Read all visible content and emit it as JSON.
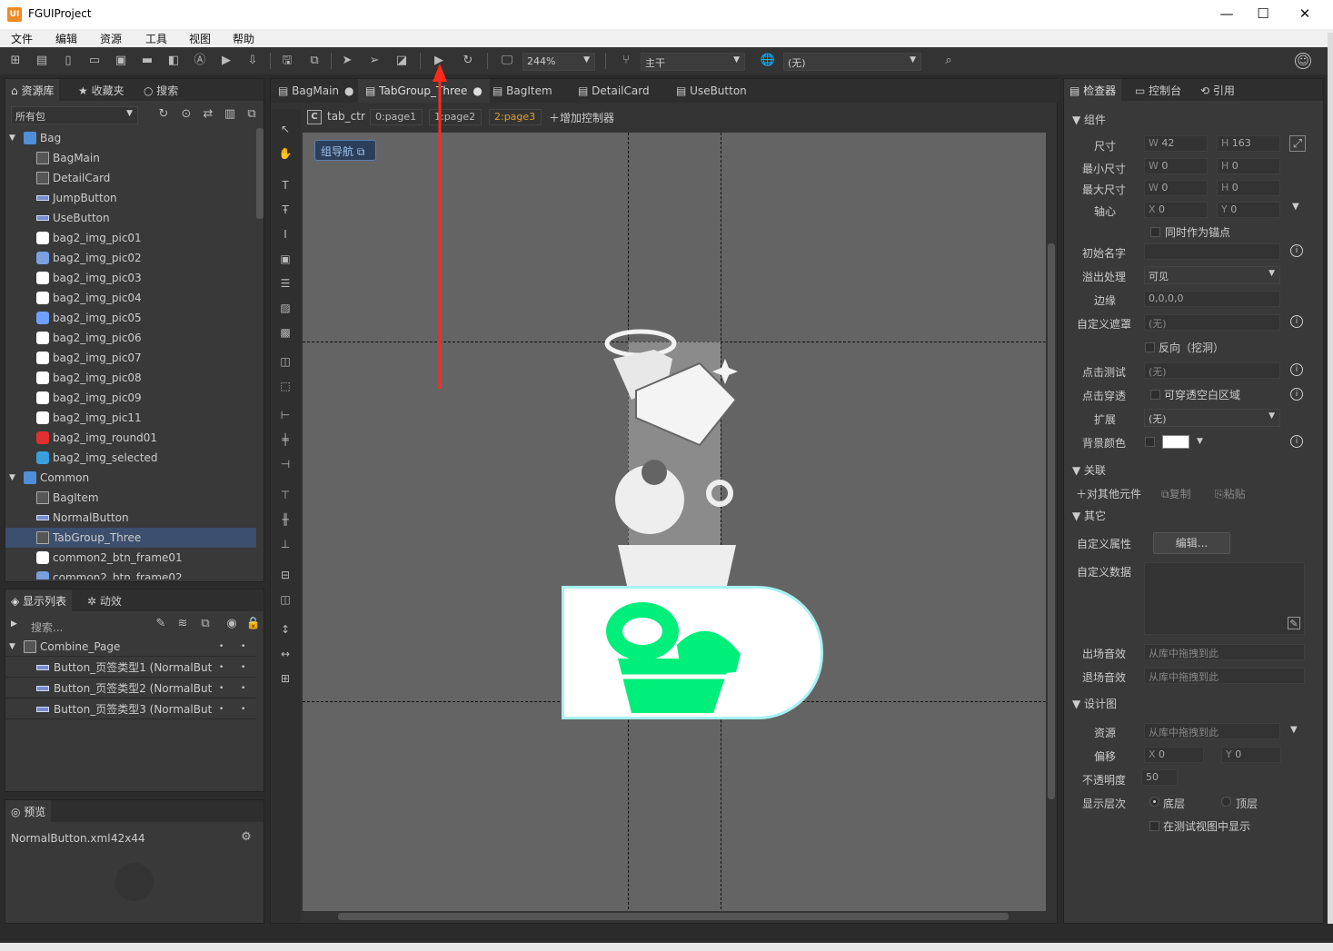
{
  "window": {
    "title": "FGUIProject",
    "logo": "UI",
    "minimize": "—",
    "maximize": "☐",
    "close": "✕"
  },
  "menu": [
    "文件",
    "编辑",
    "资源",
    "工具",
    "视图",
    "帮助"
  ],
  "toolbar": {
    "zoom": "244%",
    "branch": "主干",
    "language": "(无)"
  },
  "left": {
    "tabs": [
      "资源库",
      "收藏夹",
      "搜索"
    ],
    "package_filter": "所有包",
    "tree": [
      {
        "label": "Bag",
        "type": "folder",
        "indent": 0
      },
      {
        "label": "BagMain",
        "type": "component",
        "indent": 1
      },
      {
        "label": "DetailCard",
        "type": "component",
        "indent": 1
      },
      {
        "label": "JumpButton",
        "type": "button",
        "indent": 1
      },
      {
        "label": "UseButton",
        "type": "button",
        "indent": 1
      },
      {
        "label": "bag2_img_pic01",
        "type": "image",
        "indent": 1
      },
      {
        "label": "bag2_img_pic02",
        "type": "image",
        "indent": 1
      },
      {
        "label": "bag2_img_pic03",
        "type": "image",
        "indent": 1
      },
      {
        "label": "bag2_img_pic04",
        "type": "image",
        "indent": 1
      },
      {
        "label": "bag2_img_pic05",
        "type": "image",
        "indent": 1
      },
      {
        "label": "bag2_img_pic06",
        "type": "image",
        "indent": 1
      },
      {
        "label": "bag2_img_pic07",
        "type": "image",
        "indent": 1
      },
      {
        "label": "bag2_img_pic08",
        "type": "image",
        "indent": 1
      },
      {
        "label": "bag2_img_pic09",
        "type": "image",
        "indent": 1
      },
      {
        "label": "bag2_img_pic11",
        "type": "image",
        "indent": 1
      },
      {
        "label": "bag2_img_round01",
        "type": "image",
        "indent": 1
      },
      {
        "label": "bag2_img_selected",
        "type": "image",
        "indent": 1
      },
      {
        "label": "Common",
        "type": "folder",
        "indent": 0
      },
      {
        "label": "BagItem",
        "type": "component",
        "indent": 1
      },
      {
        "label": "NormalButton",
        "type": "button",
        "indent": 1
      },
      {
        "label": "TabGroup_Three",
        "type": "component",
        "indent": 1,
        "selected": true
      },
      {
        "label": "common2_btn_frame01",
        "type": "image",
        "indent": 1
      },
      {
        "label": "common2_btn_frame02",
        "type": "image",
        "indent": 1
      }
    ],
    "display_tabs": [
      "显示列表",
      "动效"
    ],
    "display_search_placeholder": "搜索...",
    "display_list": [
      {
        "label": "Combine_Page"
      },
      {
        "label": "Button_页签类型1 (NormalBut"
      },
      {
        "label": "Button_页签类型2 (NormalBut"
      },
      {
        "label": "Button_页签类型3 (NormalBut"
      }
    ],
    "preview_tab": "预览",
    "preview_file": "NormalButton.xml",
    "preview_size": "42x44"
  },
  "editor": {
    "doc_tabs": [
      {
        "label": "BagMain",
        "dot": "●"
      },
      {
        "label": "TabGroup_Three",
        "dot": "●",
        "active": true
      },
      {
        "label": "BagItem",
        "dot": ""
      },
      {
        "label": "DetailCard",
        "dot": ""
      },
      {
        "label": "UseButton",
        "dot": ""
      }
    ],
    "controller_icon": "C",
    "controller_name": "tab_ctr",
    "pages": [
      "0:page1",
      "1:page2",
      "2:page3"
    ],
    "active_page": "2:page3",
    "add_controller": "增加控制器",
    "group_nav": "组导航"
  },
  "right": {
    "tabs": [
      "检查器",
      "控制台",
      "引用"
    ],
    "sections": {
      "component": "组件",
      "relation": "关联",
      "other": "其它",
      "design": "设计图"
    },
    "size": {
      "label": "尺寸",
      "w": "42",
      "h": "163"
    },
    "min_size": {
      "label": "最小尺寸",
      "w": "0",
      "h": "0"
    },
    "max_size": {
      "label": "最大尺寸",
      "w": "0",
      "h": "0"
    },
    "pivot": {
      "label": "轴心",
      "x": "0",
      "y": "0"
    },
    "pivot_anchor": "同时作为锚点",
    "init_name": {
      "label": "初始名字",
      "value": ""
    },
    "overflow": {
      "label": "溢出处理",
      "value": "可见"
    },
    "margin": {
      "label": "边缘",
      "value": "0,0,0,0"
    },
    "mask": {
      "label": "自定义遮罩",
      "value": "(无)"
    },
    "reverse": "反向（挖洞）",
    "hit_test": {
      "label": "点击测试",
      "value": "(无)"
    },
    "click_through": {
      "label": "点击穿透",
      "option": "可穿透空白区域"
    },
    "extend": {
      "label": "扩展",
      "value": "(无)"
    },
    "bg_color": {
      "label": "背景颜色",
      "color": "#ffffff"
    },
    "relation_actions": {
      "add": "对其他元件",
      "copy": "复制",
      "paste": "粘贴"
    },
    "custom_props": {
      "label": "自定义属性",
      "button": "编辑..."
    },
    "custom_data": {
      "label": "自定义数据"
    },
    "enter_sound": {
      "label": "出场音效",
      "placeholder": "从库中拖拽到此"
    },
    "exit_sound": {
      "label": "退场音效",
      "placeholder": "从库中拖拽到此"
    },
    "design_res": {
      "label": "资源",
      "placeholder": "从库中拖拽到此"
    },
    "offset": {
      "label": "偏移",
      "x": "0",
      "y": "0"
    },
    "opacity": {
      "label": "不透明度",
      "value": "50"
    },
    "layer": {
      "label": "显示层次",
      "bottom": "底层",
      "top": "顶层"
    },
    "show_in_test": "在测试视图中显示",
    "axis_w": "W",
    "axis_h": "H",
    "axis_x": "X",
    "axis_y": "Y"
  },
  "colors": {
    "accent": "#00ee7a",
    "selection": "#3c4f6e",
    "arrow": "#ff2a1a"
  }
}
